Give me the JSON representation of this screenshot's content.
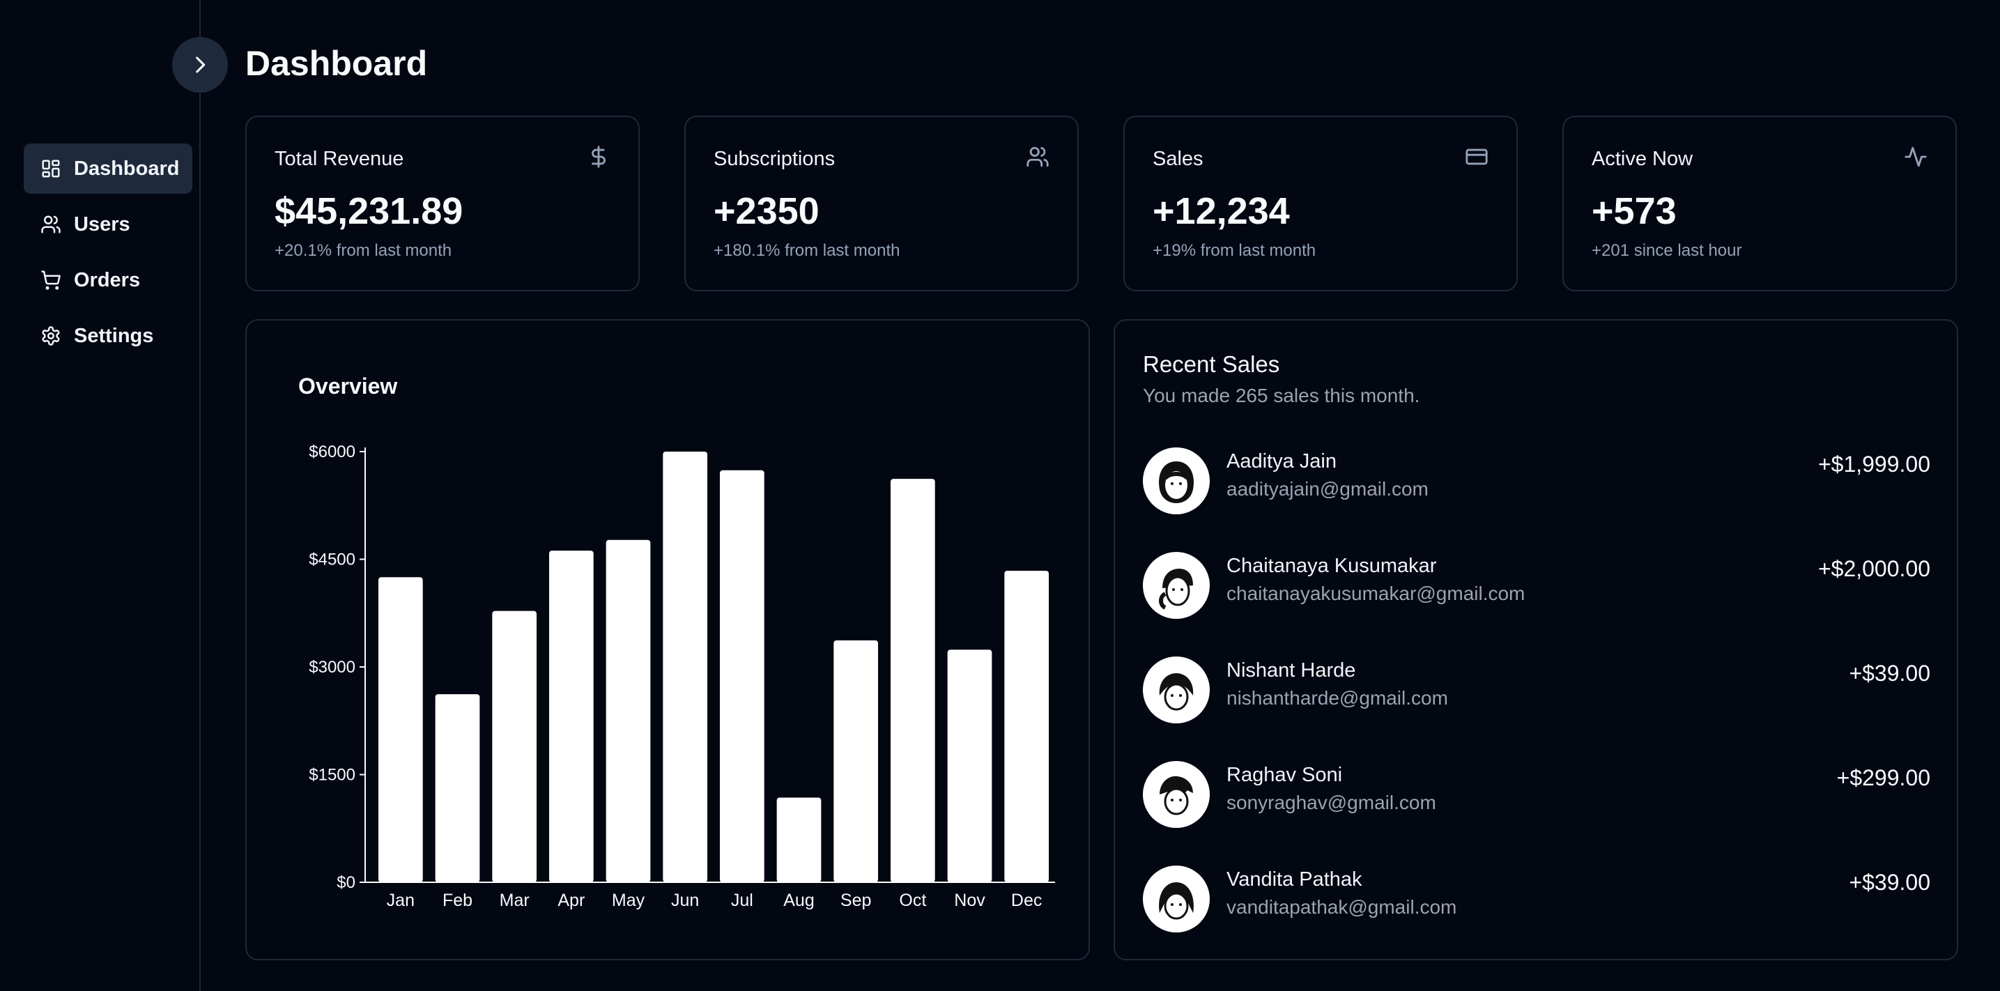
{
  "header": {
    "title": "Dashboard"
  },
  "sidebar": {
    "toggle_icon": "chevron-right-icon",
    "items": [
      {
        "label": "Dashboard",
        "icon": "dashboard-grid-icon",
        "active": true
      },
      {
        "label": "Users",
        "icon": "users-icon",
        "active": false
      },
      {
        "label": "Orders",
        "icon": "cart-icon",
        "active": false
      },
      {
        "label": "Settings",
        "icon": "gear-icon",
        "active": false
      }
    ]
  },
  "stats": [
    {
      "title": "Total Revenue",
      "value": "$45,231.89",
      "delta": "+20.1% from last month",
      "icon": "dollar-icon"
    },
    {
      "title": "Subscriptions",
      "value": "+2350",
      "delta": "+180.1% from last month",
      "icon": "users-icon"
    },
    {
      "title": "Sales",
      "value": "+12,234",
      "delta": "+19% from last month",
      "icon": "credit-card-icon"
    },
    {
      "title": "Active Now",
      "value": "+573",
      "delta": "+201 since last hour",
      "icon": "activity-icon"
    }
  ],
  "overview": {
    "title": "Overview"
  },
  "chart_data": {
    "type": "bar",
    "categories": [
      "Jan",
      "Feb",
      "Mar",
      "Apr",
      "May",
      "Jun",
      "Jul",
      "Aug",
      "Sep",
      "Oct",
      "Nov",
      "Dec"
    ],
    "values": [
      4250,
      2620,
      3780,
      4620,
      4770,
      6000,
      5740,
      1180,
      3370,
      5620,
      3240,
      4340
    ],
    "ylim": [
      0,
      6000
    ],
    "yticks": [
      0,
      1500,
      3000,
      4500,
      6000
    ],
    "ytick_labels": [
      "$0",
      "$1500",
      "$3000",
      "$4500",
      "$6000"
    ],
    "bar_color": "#ffffff",
    "grid": false
  },
  "recent_sales": {
    "title": "Recent Sales",
    "subtitle": "You made 265 sales this month.",
    "items": [
      {
        "name": "Aaditya Jain",
        "email": "aadityajain@gmail.com",
        "amount": "+$1,999.00"
      },
      {
        "name": "Chaitanaya Kusumakar",
        "email": "chaitanayakusumakar@gmail.com",
        "amount": "+$2,000.00"
      },
      {
        "name": "Nishant Harde",
        "email": "nishantharde@gmail.com",
        "amount": "+$39.00"
      },
      {
        "name": "Raghav Soni",
        "email": "sonyraghav@gmail.com",
        "amount": "+$299.00"
      },
      {
        "name": "Vandita Pathak",
        "email": "vanditapathak@gmail.com",
        "amount": "+$39.00"
      }
    ]
  },
  "colors": {
    "background": "#030712",
    "card_border": "#1f2937",
    "active_nav": "#1e293b",
    "muted_text": "#9ca3af",
    "foreground": "#f8fafc"
  }
}
